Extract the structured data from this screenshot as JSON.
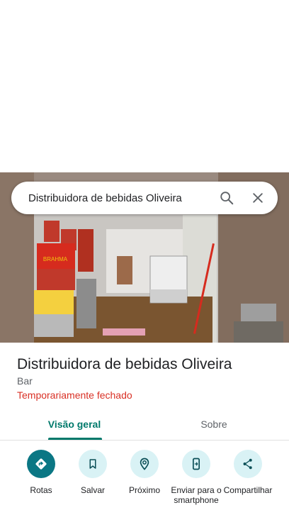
{
  "search": {
    "query": "Distribuidora de bebidas Oliveira",
    "search_icon": "search-icon",
    "close_icon": "close-icon"
  },
  "place": {
    "name": "Distribuidora de bebidas Oliveira",
    "category": "Bar",
    "status": "Temporariamente fechado"
  },
  "tabs": [
    {
      "label": "Visão geral",
      "active": true
    },
    {
      "label": "Sobre",
      "active": false
    }
  ],
  "actions": [
    {
      "label": "Rotas",
      "icon": "directions-icon"
    },
    {
      "label": "Salvar",
      "icon": "bookmark-icon"
    },
    {
      "label": "Próximo",
      "icon": "nearby-pin-icon"
    },
    {
      "label": "Enviar para o smartphone",
      "icon": "send-to-phone-icon"
    },
    {
      "label": "Compartilhar",
      "icon": "share-icon"
    }
  ],
  "photo_signs": {
    "brahma": "BRAHMA"
  },
  "colors": {
    "accent": "#00796b",
    "status_closed": "#d93025",
    "primary_action": "#0b7784",
    "action_bg": "#d9f2f5"
  }
}
